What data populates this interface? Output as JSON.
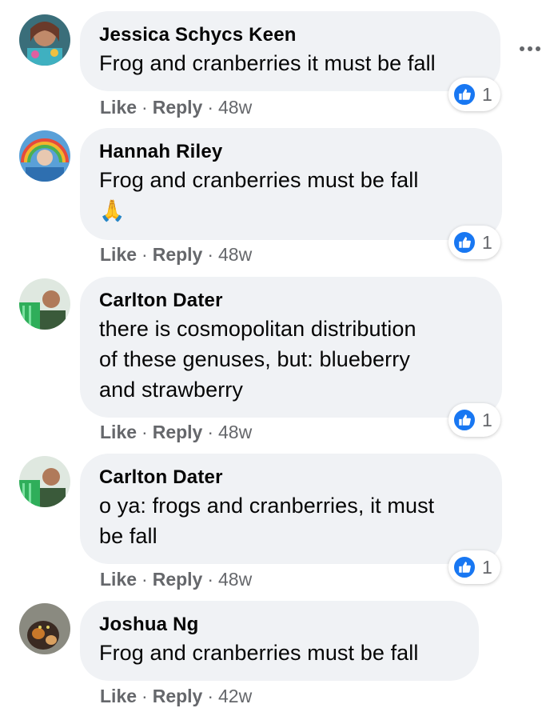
{
  "comments": [
    {
      "author": "Jessica Schycs Keen",
      "text": "Frog and cranberries it must be fall",
      "like_label": "Like",
      "reply_label": "Reply",
      "sep": "·",
      "time": "48w",
      "reaction_count": "1",
      "avatar": "avatar-photo"
    },
    {
      "author": "Hannah Riley",
      "text": "Frog and cranberries must be fall",
      "emoji": "🙏",
      "like_label": "Like",
      "reply_label": "Reply",
      "sep": "·",
      "time": "48w",
      "reaction_count": "1",
      "avatar": "avatar-photo"
    },
    {
      "author": "Carlton Dater",
      "text_lines": [
        "there is cosmopolitan distribution",
        "of these genuses, but: blueberry",
        "and strawberry"
      ],
      "like_label": "Like",
      "reply_label": "Reply",
      "sep": "·",
      "time": "48w",
      "reaction_count": "1",
      "avatar": "avatar-photo"
    },
    {
      "author": "Carlton Dater",
      "text_lines": [
        "o ya: frogs and cranberries, it must",
        "be fall"
      ],
      "like_label": "Like",
      "reply_label": "Reply",
      "sep": "·",
      "time": "48w",
      "reaction_count": "1",
      "avatar": "avatar-photo"
    },
    {
      "author": "Joshua Ng",
      "text": "Frog and cranberries must be fall",
      "like_label": "Like",
      "reply_label": "Reply",
      "sep": "·",
      "time": "42w",
      "avatar": "avatar-photo"
    }
  ],
  "colors": {
    "bubble": "#f0f2f5",
    "meta": "#65676b",
    "like_blue": "#1877f2"
  },
  "icons": {
    "more": "more-options-icon",
    "reaction": "like-reaction-icon"
  }
}
